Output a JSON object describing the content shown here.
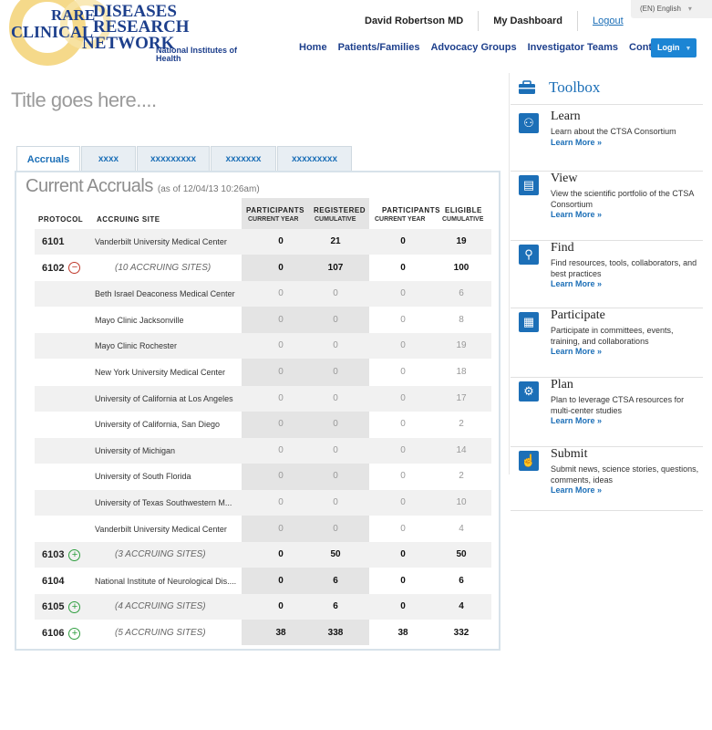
{
  "logo": {
    "rare": "RARE",
    "clinical": "CLINICAL",
    "diseases": "DISEASES",
    "research": "RESEARCH",
    "network": "NETWORK",
    "nih": "National Institutes of Health"
  },
  "user": {
    "name": "David Robertson MD",
    "dashboard": "My Dashboard",
    "logout": "Logout"
  },
  "language": {
    "selected": "(EN) English"
  },
  "nav": [
    "Home",
    "Patients/Families",
    "Advocacy Groups",
    "Investigator Teams",
    "Contact"
  ],
  "login_label": "Login",
  "page_title": "Title goes here....",
  "tabs": [
    "Accruals",
    "xxxx",
    "xxxxxxxxx",
    "xxxxxxx",
    "xxxxxxxxx"
  ],
  "accruals": {
    "title": "Current Accruals",
    "as_of": "(as of 12/04/13 10:26am)",
    "headers": {
      "protocol": "PROTOCOL",
      "site": "ACCRUING SITE",
      "participants": "PARTICIPANTS",
      "registered": "REGISTERED",
      "participants2": "PARTICIPANTS",
      "eligible": "ELIGIBLE",
      "current_year": "CURRENT YEAR",
      "cumulative": "CUMULATIVE",
      "current_year2": "CURRENT YEAR",
      "cumulative2": "CUMULATIVE"
    },
    "rows": [
      {
        "protocol": "6101",
        "site": "Vanderbilt University Medical Center",
        "v1": "0",
        "v2": "21",
        "v3": "0",
        "v4": "19"
      },
      {
        "protocol": "6102",
        "site": "(10 ACCRUING SITES)",
        "v1": "0",
        "v2": "107",
        "v3": "0",
        "v4": "100"
      },
      {
        "protocol": "",
        "site": "Beth Israel Deaconess Medical Center",
        "v1": "0",
        "v2": "0",
        "v3": "0",
        "v4": "6"
      },
      {
        "protocol": "",
        "site": "Mayo Clinic Jacksonville",
        "v1": "0",
        "v2": "0",
        "v3": "0",
        "v4": "8"
      },
      {
        "protocol": "",
        "site": "Mayo Clinic Rochester",
        "v1": "0",
        "v2": "0",
        "v3": "0",
        "v4": "19"
      },
      {
        "protocol": "",
        "site": "New York University Medical Center",
        "v1": "0",
        "v2": "0",
        "v3": "0",
        "v4": "18"
      },
      {
        "protocol": "",
        "site": "University of California at Los Angeles",
        "v1": "0",
        "v2": "0",
        "v3": "0",
        "v4": "17"
      },
      {
        "protocol": "",
        "site": "University of California, San Diego",
        "v1": "0",
        "v2": "0",
        "v3": "0",
        "v4": "2"
      },
      {
        "protocol": "",
        "site": "University of Michigan",
        "v1": "0",
        "v2": "0",
        "v3": "0",
        "v4": "14"
      },
      {
        "protocol": "",
        "site": "University of South Florida",
        "v1": "0",
        "v2": "0",
        "v3": "0",
        "v4": "2"
      },
      {
        "protocol": "",
        "site": "University of Texas Southwestern M...",
        "v1": "0",
        "v2": "0",
        "v3": "0",
        "v4": "10"
      },
      {
        "protocol": "",
        "site": "Vanderbilt University Medical Center",
        "v1": "0",
        "v2": "0",
        "v3": "0",
        "v4": "4"
      },
      {
        "protocol": "6103",
        "site": "(3 ACCRUING SITES)",
        "v1": "0",
        "v2": "50",
        "v3": "0",
        "v4": "50"
      },
      {
        "protocol": "6104",
        "site": "National Institute of Neurological Dis....",
        "v1": "0",
        "v2": "6",
        "v3": "0",
        "v4": "6"
      },
      {
        "protocol": "6105",
        "site": "(4 ACCRUING SITES)",
        "v1": "0",
        "v2": "6",
        "v3": "0",
        "v4": "4"
      },
      {
        "protocol": "6106",
        "site": "(5 ACCRUING SITES)",
        "v1": "38",
        "v2": "338",
        "v3": "38",
        "v4": "332"
      }
    ]
  },
  "toolbox": {
    "title": "Toolbox",
    "items": [
      {
        "title": "Learn",
        "desc": "Learn about the CTSA Consortium",
        "link": "Learn More »",
        "icon": "share-nodes-icon"
      },
      {
        "title": "View",
        "desc": "View the scientific portfolio of the CTSA Consortium",
        "link": "Learn More »",
        "icon": "document-icon"
      },
      {
        "title": "Find",
        "desc": "Find resources, tools, collaborators, and best practices",
        "link": "Learn More »",
        "icon": "search-icon"
      },
      {
        "title": "Participate",
        "desc": "Participate in committees, events, training, and collaborations",
        "link": "Learn More »",
        "icon": "calendar-icon"
      },
      {
        "title": "Plan",
        "desc": "Plan to leverage CTSA resources for multi-center studies",
        "link": "Learn More »",
        "icon": "plan-icon"
      },
      {
        "title": "Submit",
        "desc": "Submit news, science stories, questions, comments, ideas",
        "link": "Learn More »",
        "icon": "pointer-icon"
      }
    ]
  }
}
